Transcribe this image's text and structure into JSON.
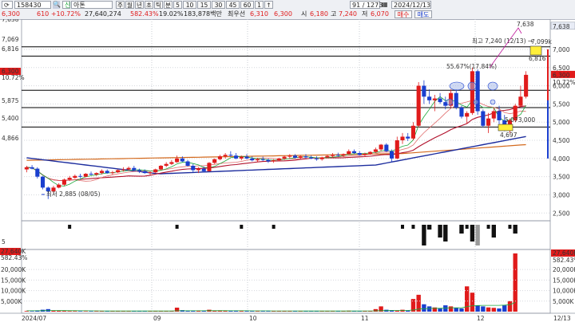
{
  "toolbar": {
    "code": "158430",
    "stock_name": "아톤",
    "period_buttons": [
      "주",
      "월",
      "년",
      "초",
      "틱",
      "분",
      "5",
      "10",
      "15",
      "30",
      "45",
      "60",
      "1",
      "↑"
    ],
    "bar_count": "91 / 1273",
    "date": "2024/12/13",
    "row2": {
      "price": "6,300",
      "change": "610 +10.72%",
      "volume": "27,640,274",
      "volume_ratio": "582.43%",
      "turnover": "19.02%",
      "amount": "183,878백만",
      "hoga_label": "최우선",
      "bid1": "6,310",
      "ask1": "6,300",
      "open_label": "시",
      "open": "6,180",
      "high_label": "고",
      "high": "7,240",
      "low_label": "저",
      "low": "6,070",
      "buy": "매수",
      "sell": "매도"
    }
  },
  "chart_data": {
    "type": "candlestick",
    "price_axis": [
      "7,000",
      "6,500",
      "6,000",
      "5,500",
      "5,000",
      "4,500",
      "4,000",
      "3,500",
      "3,000",
      "2,500"
    ],
    "price_labels_left": [
      "7,638",
      "7,069",
      "6,816",
      "6,300",
      "10.72%",
      "5,875",
      "5,400",
      "4,866",
      "5"
    ],
    "price_labels_right": [
      "7,638",
      "6,300",
      "10.72%"
    ],
    "hlines": [
      7069,
      6816,
      5875,
      5400,
      4866
    ],
    "annotations": {
      "high": "최고 7,240 (12/13) →",
      "low": "최저 2,885 (08/05)",
      "peak": "7,638",
      "pct": "55.67%(17.84%)",
      "v7099": "7,099k",
      "v6816": "6,816",
      "v4697": "4,697",
      "v5073": "5,073,000"
    },
    "volume_axis": [
      "20,000K",
      "15,000K",
      "10,000K",
      "5,000K"
    ],
    "volume_labels_left": [
      "27,640K",
      "582.43%",
      "20,000K",
      "15,000K",
      "10,000K",
      "5,000K"
    ],
    "volume_labels_right": [
      "27,640K",
      "582.43%"
    ],
    "x_labels": [
      "2024/07",
      "09",
      "10",
      "11",
      "12",
      "12/13"
    ],
    "candles": [
      {
        "o": 3700,
        "h": 3800,
        "l": 3620,
        "c": 3760
      },
      {
        "o": 3760,
        "h": 3820,
        "l": 3700,
        "c": 3720
      },
      {
        "o": 3720,
        "h": 3760,
        "l": 3450,
        "c": 3500
      },
      {
        "o": 3500,
        "h": 3520,
        "l": 3150,
        "c": 3200
      },
      {
        "o": 3200,
        "h": 3230,
        "l": 2885,
        "c": 3100
      },
      {
        "o": 3100,
        "h": 3250,
        "l": 3050,
        "c": 3200
      },
      {
        "o": 3200,
        "h": 3320,
        "l": 3180,
        "c": 3280
      },
      {
        "o": 3280,
        "h": 3450,
        "l": 3250,
        "c": 3420
      },
      {
        "o": 3420,
        "h": 3520,
        "l": 3380,
        "c": 3470
      },
      {
        "o": 3470,
        "h": 3560,
        "l": 3440,
        "c": 3520
      },
      {
        "o": 3520,
        "h": 3580,
        "l": 3460,
        "c": 3500
      },
      {
        "o": 3500,
        "h": 3600,
        "l": 3480,
        "c": 3580
      },
      {
        "o": 3580,
        "h": 3640,
        "l": 3540,
        "c": 3560
      },
      {
        "o": 3560,
        "h": 3620,
        "l": 3520,
        "c": 3600
      },
      {
        "o": 3600,
        "h": 3700,
        "l": 3560,
        "c": 3660
      },
      {
        "o": 3660,
        "h": 3700,
        "l": 3580,
        "c": 3600
      },
      {
        "o": 3600,
        "h": 3660,
        "l": 3560,
        "c": 3620
      },
      {
        "o": 3620,
        "h": 3700,
        "l": 3600,
        "c": 3680
      },
      {
        "o": 3680,
        "h": 3760,
        "l": 3640,
        "c": 3700
      },
      {
        "o": 3700,
        "h": 3780,
        "l": 3660,
        "c": 3740
      },
      {
        "o": 3740,
        "h": 3800,
        "l": 3660,
        "c": 3680
      },
      {
        "o": 3680,
        "h": 3720,
        "l": 3600,
        "c": 3650
      },
      {
        "o": 3650,
        "h": 3700,
        "l": 3580,
        "c": 3600
      },
      {
        "o": 3600,
        "h": 3650,
        "l": 3540,
        "c": 3620
      },
      {
        "o": 3620,
        "h": 3720,
        "l": 3600,
        "c": 3700
      },
      {
        "o": 3700,
        "h": 3820,
        "l": 3680,
        "c": 3800
      },
      {
        "o": 3800,
        "h": 3900,
        "l": 3760,
        "c": 3850
      },
      {
        "o": 3850,
        "h": 3960,
        "l": 3820,
        "c": 3900
      },
      {
        "o": 3900,
        "h": 4080,
        "l": 3880,
        "c": 4000
      },
      {
        "o": 4000,
        "h": 4060,
        "l": 3900,
        "c": 3920
      },
      {
        "o": 3920,
        "h": 3960,
        "l": 3780,
        "c": 3800
      },
      {
        "o": 3800,
        "h": 3850,
        "l": 3620,
        "c": 3680
      },
      {
        "o": 3680,
        "h": 3760,
        "l": 3600,
        "c": 3720
      },
      {
        "o": 3720,
        "h": 3780,
        "l": 3620,
        "c": 3650
      },
      {
        "o": 3650,
        "h": 3900,
        "l": 3640,
        "c": 3880
      },
      {
        "o": 3880,
        "h": 4000,
        "l": 3850,
        "c": 3980
      },
      {
        "o": 3980,
        "h": 4100,
        "l": 3950,
        "c": 4060
      },
      {
        "o": 4060,
        "h": 4150,
        "l": 4000,
        "c": 4100
      },
      {
        "o": 4100,
        "h": 4200,
        "l": 4050,
        "c": 4080
      },
      {
        "o": 4080,
        "h": 4150,
        "l": 3980,
        "c": 4000
      },
      {
        "o": 4000,
        "h": 4080,
        "l": 3950,
        "c": 4050
      },
      {
        "o": 4050,
        "h": 4120,
        "l": 3980,
        "c": 4000
      },
      {
        "o": 4000,
        "h": 4060,
        "l": 3920,
        "c": 3950
      },
      {
        "o": 3950,
        "h": 4020,
        "l": 3900,
        "c": 3980
      },
      {
        "o": 3980,
        "h": 4050,
        "l": 3930,
        "c": 3960
      },
      {
        "o": 3960,
        "h": 4000,
        "l": 3880,
        "c": 3920
      },
      {
        "o": 3920,
        "h": 3980,
        "l": 3880,
        "c": 3950
      },
      {
        "o": 3950,
        "h": 4020,
        "l": 3920,
        "c": 4000
      },
      {
        "o": 4000,
        "h": 4080,
        "l": 3960,
        "c": 4050
      },
      {
        "o": 4050,
        "h": 4120,
        "l": 4000,
        "c": 4080
      },
      {
        "o": 4080,
        "h": 4120,
        "l": 4000,
        "c": 4020
      },
      {
        "o": 4020,
        "h": 4080,
        "l": 3980,
        "c": 4060
      },
      {
        "o": 4060,
        "h": 4120,
        "l": 4000,
        "c": 4030
      },
      {
        "o": 4030,
        "h": 4080,
        "l": 3980,
        "c": 4000
      },
      {
        "o": 4000,
        "h": 4060,
        "l": 3940,
        "c": 3980
      },
      {
        "o": 3980,
        "h": 4050,
        "l": 3940,
        "c": 4030
      },
      {
        "o": 4030,
        "h": 4100,
        "l": 4000,
        "c": 4070
      },
      {
        "o": 4070,
        "h": 4150,
        "l": 4020,
        "c": 4100
      },
      {
        "o": 4100,
        "h": 4160,
        "l": 4050,
        "c": 4080
      },
      {
        "o": 4080,
        "h": 4140,
        "l": 4040,
        "c": 4120
      },
      {
        "o": 4120,
        "h": 4250,
        "l": 4100,
        "c": 4200
      },
      {
        "o": 4200,
        "h": 4250,
        "l": 4120,
        "c": 4150
      },
      {
        "o": 4150,
        "h": 4200,
        "l": 4080,
        "c": 4100
      },
      {
        "o": 4100,
        "h": 4160,
        "l": 4050,
        "c": 4130
      },
      {
        "o": 4130,
        "h": 4200,
        "l": 4100,
        "c": 4180
      },
      {
        "o": 4180,
        "h": 4300,
        "l": 4150,
        "c": 4250
      },
      {
        "o": 4250,
        "h": 4400,
        "l": 4200,
        "c": 4380
      },
      {
        "o": 4380,
        "h": 4420,
        "l": 4180,
        "c": 4200
      },
      {
        "o": 4200,
        "h": 4250,
        "l": 3900,
        "c": 4000
      },
      {
        "o": 4000,
        "h": 4600,
        "l": 3980,
        "c": 4500
      },
      {
        "o": 4500,
        "h": 4700,
        "l": 4400,
        "c": 4600
      },
      {
        "o": 4600,
        "h": 4700,
        "l": 4480,
        "c": 4550
      },
      {
        "o": 4550,
        "h": 5000,
        "l": 4500,
        "c": 4900
      },
      {
        "o": 4900,
        "h": 6100,
        "l": 4850,
        "c": 6000
      },
      {
        "o": 6000,
        "h": 6150,
        "l": 5500,
        "c": 5700
      },
      {
        "o": 5700,
        "h": 5900,
        "l": 5500,
        "c": 5600
      },
      {
        "o": 5600,
        "h": 5750,
        "l": 5300,
        "c": 5650
      },
      {
        "o": 5650,
        "h": 5800,
        "l": 5500,
        "c": 5550
      },
      {
        "o": 5550,
        "h": 5700,
        "l": 5350,
        "c": 5450
      },
      {
        "o": 5450,
        "h": 5900,
        "l": 5400,
        "c": 5800
      },
      {
        "o": 5800,
        "h": 5900,
        "l": 5350,
        "c": 5400
      },
      {
        "o": 5400,
        "h": 5450,
        "l": 5100,
        "c": 5150
      },
      {
        "o": 5150,
        "h": 5300,
        "l": 4950,
        "c": 5250
      },
      {
        "o": 5250,
        "h": 6500,
        "l": 5200,
        "c": 6400
      },
      {
        "o": 6400,
        "h": 6450,
        "l": 5200,
        "c": 5300
      },
      {
        "o": 5300,
        "h": 5350,
        "l": 4850,
        "c": 4900
      },
      {
        "o": 4900,
        "h": 5250,
        "l": 4700,
        "c": 5100
      },
      {
        "o": 5100,
        "h": 5400,
        "l": 5000,
        "c": 5300
      },
      {
        "o": 5300,
        "h": 5450,
        "l": 4950,
        "c": 5050
      },
      {
        "o": 5050,
        "h": 5200,
        "l": 4750,
        "c": 4800
      },
      {
        "o": 4800,
        "h": 5100,
        "l": 4697,
        "c": 5050
      },
      {
        "o": 5050,
        "h": 5500,
        "l": 5000,
        "c": 5450
      },
      {
        "o": 5450,
        "h": 6000,
        "l": 5400,
        "c": 5700
      },
      {
        "o": 5700,
        "h": 6400,
        "l": 5650,
        "c": 6300
      }
    ],
    "volumes": [
      300,
      250,
      600,
      900,
      1200,
      500,
      400,
      350,
      300,
      280,
      250,
      220,
      240,
      260,
      230,
      210,
      200,
      220,
      250,
      260,
      230,
      220,
      210,
      240,
      260,
      300,
      320,
      280,
      1900,
      700,
      500,
      400,
      420,
      380,
      900,
      450,
      600,
      500,
      420,
      380,
      360,
      340,
      320,
      300,
      310,
      290,
      280,
      300,
      320,
      340,
      310,
      300,
      290,
      280,
      270,
      290,
      310,
      330,
      300,
      320,
      450,
      380,
      340,
      320,
      360,
      1200,
      2500,
      900,
      700,
      600,
      900,
      500,
      6000,
      8000,
      3500,
      2500,
      2000,
      1500,
      3000,
      2500,
      1800,
      1500,
      12000,
      9000,
      3000,
      2500,
      2000,
      1800,
      1500,
      3000,
      5000,
      27640
    ],
    "volume_ma": [
      400,
      400,
      420,
      460,
      520,
      520,
      500,
      480,
      460,
      440,
      420,
      400,
      380,
      360,
      340,
      320,
      310,
      300,
      300,
      300,
      300,
      300,
      300,
      300,
      300,
      310,
      320,
      320,
      400,
      420,
      420,
      420,
      420,
      420,
      440,
      440,
      440,
      440,
      430,
      420,
      410,
      400,
      390,
      380,
      370,
      360,
      350,
      340,
      330,
      330,
      330,
      320,
      320,
      310,
      310,
      310,
      310,
      310,
      310,
      310,
      320,
      320,
      320,
      330,
      340,
      380,
      460,
      500,
      520,
      540,
      560,
      560,
      800,
      1200,
      1400,
      1500,
      1600,
      1600,
      1700,
      1800,
      1800,
      1800,
      2400,
      2800,
      2900,
      3000,
      3000,
      3000,
      3000,
      3100,
      3300,
      4400
    ],
    "volume_dark": [
      0,
      0,
      0,
      0,
      0,
      0,
      0,
      0,
      0,
      0,
      0,
      0,
      0,
      0,
      0,
      0,
      0,
      0,
      0,
      0,
      0,
      0,
      0,
      0,
      0,
      0,
      0,
      0,
      0,
      0,
      0,
      0,
      0,
      0,
      0,
      0,
      0,
      0,
      0,
      0,
      0,
      0,
      0,
      0,
      0,
      0,
      0,
      0,
      0,
      0,
      0,
      0,
      0,
      0,
      0,
      0,
      0,
      0,
      0,
      0,
      0,
      0,
      0,
      0,
      0,
      0,
      0,
      0,
      0,
      0,
      0,
      0,
      0,
      0,
      1,
      1,
      0,
      1,
      1,
      0,
      0,
      1,
      0,
      1,
      1,
      0,
      0,
      1,
      0,
      0,
      0,
      1
    ],
    "legend_none": ""
  },
  "colors": {
    "up": "#e01b1b",
    "down": "#1a3fcf",
    "ma5": "#1aa83a",
    "ma20": "#b1102b",
    "ma60": "#1d2d9e",
    "ma120": "#d46a1e",
    "annotation": "#c0179b",
    "toolbar_bg": "#eef0f4"
  }
}
